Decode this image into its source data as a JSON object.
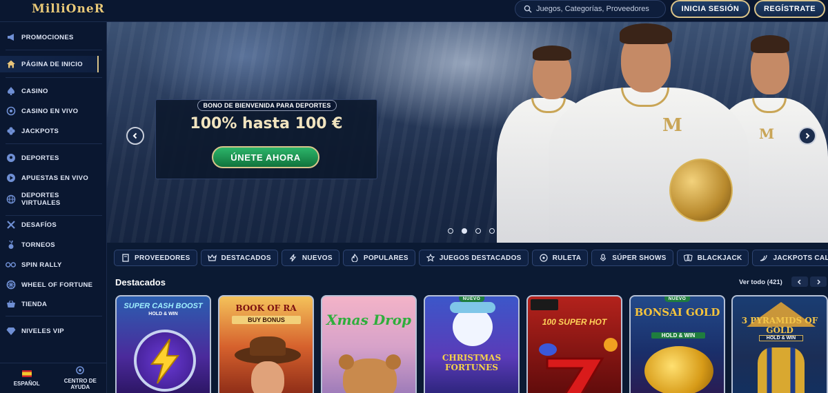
{
  "header": {
    "logo": "MilliOneR",
    "search_placeholder": "Juegos, Categorías, Proveedores",
    "login_label": "INICIA SESIÓN",
    "register_label": "REGÍSTRATE"
  },
  "sidebar": {
    "items": [
      {
        "label": "PROMOCIONES",
        "icon": "megaphone-icon"
      },
      {
        "label": "PÁGINA DE INICIO",
        "icon": "home-icon"
      },
      {
        "label": "CASINO",
        "icon": "spade-icon"
      },
      {
        "label": "CASINO EN VIVO",
        "icon": "live-chip-icon"
      },
      {
        "label": "JACKPOTS",
        "icon": "clover-icon"
      },
      {
        "label": "DEPORTES",
        "icon": "soccer-ball-icon"
      },
      {
        "label": "APUESTAS EN VIVO",
        "icon": "live-bet-icon"
      },
      {
        "label": "DEPORTES VIRTUALES",
        "icon": "globe-icon"
      },
      {
        "label": "DESAFÍOS",
        "icon": "crossed-swords-icon"
      },
      {
        "label": "TORNEOS",
        "icon": "medal-icon"
      },
      {
        "label": "SPIN RALLY",
        "icon": "rally-icon"
      },
      {
        "label": "WHEEL OF FORTUNE",
        "icon": "wheel-icon"
      },
      {
        "label": "TIENDA",
        "icon": "basket-icon"
      },
      {
        "label": "NIVELES VIP",
        "icon": "diamond-icon"
      }
    ],
    "footer": {
      "language": "ESPAÑOL",
      "help_line1": "CENTRO DE",
      "help_line2": "AYUDA"
    }
  },
  "hero": {
    "tag": "BONO DE BIENVENIDA PARA DEPORTES",
    "title": "100% hasta 100 €",
    "cta": "ÚNETE AHORA",
    "slide_count": 4,
    "active_slide": 2
  },
  "categories": [
    {
      "label": "PROVEEDORES",
      "icon": "book-icon"
    },
    {
      "label": "DESTACADOS",
      "icon": "crown-icon"
    },
    {
      "label": "NUEVOS",
      "icon": "bolt-icon"
    },
    {
      "label": "POPULARES",
      "icon": "flame-icon"
    },
    {
      "label": "JUEGOS DESTACADOS",
      "icon": "star-icon"
    },
    {
      "label": "RULETA",
      "icon": "roulette-icon"
    },
    {
      "label": "SÚPER SHOWS",
      "icon": "microphone-icon"
    },
    {
      "label": "BLACKJACK",
      "icon": "cards-icon"
    },
    {
      "label": "JACKPOTS CALIENTES",
      "icon": "chili-icon"
    }
  ],
  "featured": {
    "title": "Destacados",
    "view_all": "Ver todo (421)",
    "new_badge": "NUEVO",
    "games": [
      {
        "name": "SUPER CASH BOOST",
        "sub": "HOLD & WIN"
      },
      {
        "name": "BOOK OF RA",
        "sub": "BUY BONUS"
      },
      {
        "name": "Xmas Drop",
        "sub": ""
      },
      {
        "name": "CHRISTMAS FORTUNES",
        "sub": ""
      },
      {
        "name": "100 SUPER HOT",
        "sub": ""
      },
      {
        "name": "BONSAI GOLD",
        "sub": "HOLD & WIN"
      },
      {
        "name": "3 PYRAMIDS OF GOLD",
        "sub": "HOLD & WIN"
      }
    ]
  }
}
